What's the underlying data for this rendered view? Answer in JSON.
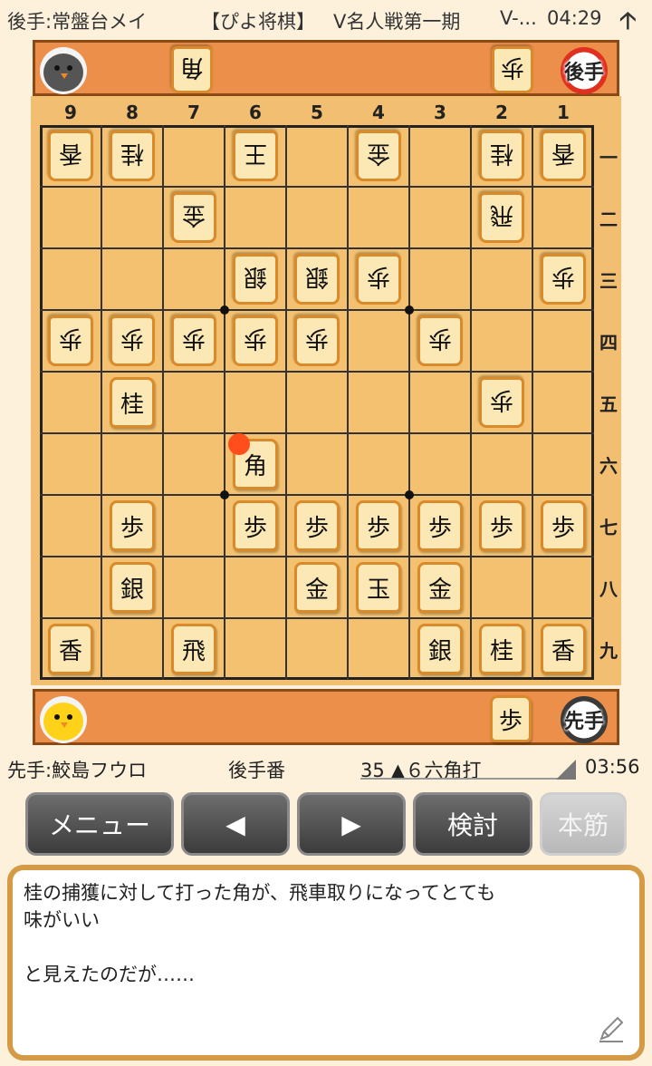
{
  "status_bar": {
    "gote_player": "後手:常盤台メイ",
    "tournament": "【ぴよ将棋】",
    "event": "V名人戦第一期",
    "event_more": "V-...",
    "time": "04:29",
    "arrow": "🡡"
  },
  "board": {
    "file_labels": [
      "9",
      "8",
      "7",
      "6",
      "5",
      "4",
      "3",
      "2",
      "1"
    ],
    "rank_labels": [
      "一",
      "二",
      "三",
      "四",
      "五",
      "六",
      "七",
      "八",
      "九"
    ],
    "pieces": [
      {
        "file": 9,
        "rank": 1,
        "label": "香",
        "owner": "gote"
      },
      {
        "file": 8,
        "rank": 1,
        "label": "桂",
        "owner": "gote"
      },
      {
        "file": 6,
        "rank": 1,
        "label": "王",
        "owner": "gote"
      },
      {
        "file": 4,
        "rank": 1,
        "label": "金",
        "owner": "gote"
      },
      {
        "file": 2,
        "rank": 1,
        "label": "桂",
        "owner": "gote"
      },
      {
        "file": 1,
        "rank": 1,
        "label": "香",
        "owner": "gote"
      },
      {
        "file": 7,
        "rank": 2,
        "label": "金",
        "owner": "gote"
      },
      {
        "file": 2,
        "rank": 2,
        "label": "飛",
        "owner": "gote"
      },
      {
        "file": 6,
        "rank": 3,
        "label": "銀",
        "owner": "gote"
      },
      {
        "file": 5,
        "rank": 3,
        "label": "銀",
        "owner": "gote"
      },
      {
        "file": 4,
        "rank": 3,
        "label": "歩",
        "owner": "gote"
      },
      {
        "file": 1,
        "rank": 3,
        "label": "歩",
        "owner": "gote"
      },
      {
        "file": 9,
        "rank": 4,
        "label": "歩",
        "owner": "gote"
      },
      {
        "file": 8,
        "rank": 4,
        "label": "歩",
        "owner": "gote"
      },
      {
        "file": 7,
        "rank": 4,
        "label": "歩",
        "owner": "gote"
      },
      {
        "file": 6,
        "rank": 4,
        "label": "歩",
        "owner": "gote"
      },
      {
        "file": 5,
        "rank": 4,
        "label": "歩",
        "owner": "gote"
      },
      {
        "file": 3,
        "rank": 4,
        "label": "歩",
        "owner": "gote"
      },
      {
        "file": 8,
        "rank": 5,
        "label": "桂",
        "owner": "sente"
      },
      {
        "file": 2,
        "rank": 5,
        "label": "歩",
        "owner": "gote"
      },
      {
        "file": 6,
        "rank": 6,
        "label": "角",
        "owner": "sente"
      },
      {
        "file": 8,
        "rank": 7,
        "label": "歩",
        "owner": "sente"
      },
      {
        "file": 6,
        "rank": 7,
        "label": "歩",
        "owner": "sente"
      },
      {
        "file": 5,
        "rank": 7,
        "label": "歩",
        "owner": "sente"
      },
      {
        "file": 4,
        "rank": 7,
        "label": "歩",
        "owner": "sente"
      },
      {
        "file": 3,
        "rank": 7,
        "label": "歩",
        "owner": "sente"
      },
      {
        "file": 2,
        "rank": 7,
        "label": "歩",
        "owner": "sente"
      },
      {
        "file": 1,
        "rank": 7,
        "label": "歩",
        "owner": "sente"
      },
      {
        "file": 8,
        "rank": 8,
        "label": "銀",
        "owner": "sente"
      },
      {
        "file": 5,
        "rank": 8,
        "label": "金",
        "owner": "sente"
      },
      {
        "file": 4,
        "rank": 8,
        "label": "玉",
        "owner": "sente"
      },
      {
        "file": 3,
        "rank": 8,
        "label": "金",
        "owner": "sente"
      },
      {
        "file": 9,
        "rank": 9,
        "label": "香",
        "owner": "sente"
      },
      {
        "file": 7,
        "rank": 9,
        "label": "飛",
        "owner": "sente"
      },
      {
        "file": 3,
        "rank": 9,
        "label": "銀",
        "owner": "sente"
      },
      {
        "file": 2,
        "rank": 9,
        "label": "桂",
        "owner": "sente"
      },
      {
        "file": 1,
        "rank": 9,
        "label": "香",
        "owner": "sente"
      }
    ],
    "last_move": {
      "file": 6,
      "rank": 6
    }
  },
  "gote_hand": {
    "pieces": [
      {
        "label": "角"
      },
      {
        "label": "歩"
      }
    ],
    "badge": "後手",
    "badge_color": "#e03020"
  },
  "sente_hand": {
    "pieces": [
      {
        "label": "歩"
      }
    ],
    "badge": "先手",
    "badge_color": "#3a3a3a"
  },
  "info_bar": {
    "sente_player": "先手:鮫島フウロ",
    "turn": "後手番",
    "move": "35 ▲６六角打",
    "clock": "03:56"
  },
  "buttons": {
    "menu": "メニュー",
    "prev": "◀",
    "next": "▶",
    "analyze": "検討",
    "mainline": "本筋"
  },
  "comment": {
    "line1": "桂の捕獲に対して打った角が、飛車取りになってとても",
    "line2": "味がいい",
    "line3": "",
    "line4": "と見えたのだが……"
  },
  "colors": {
    "tray": "#ec8f4a",
    "board": "#f3c170",
    "marker": "#ff4d1c"
  }
}
